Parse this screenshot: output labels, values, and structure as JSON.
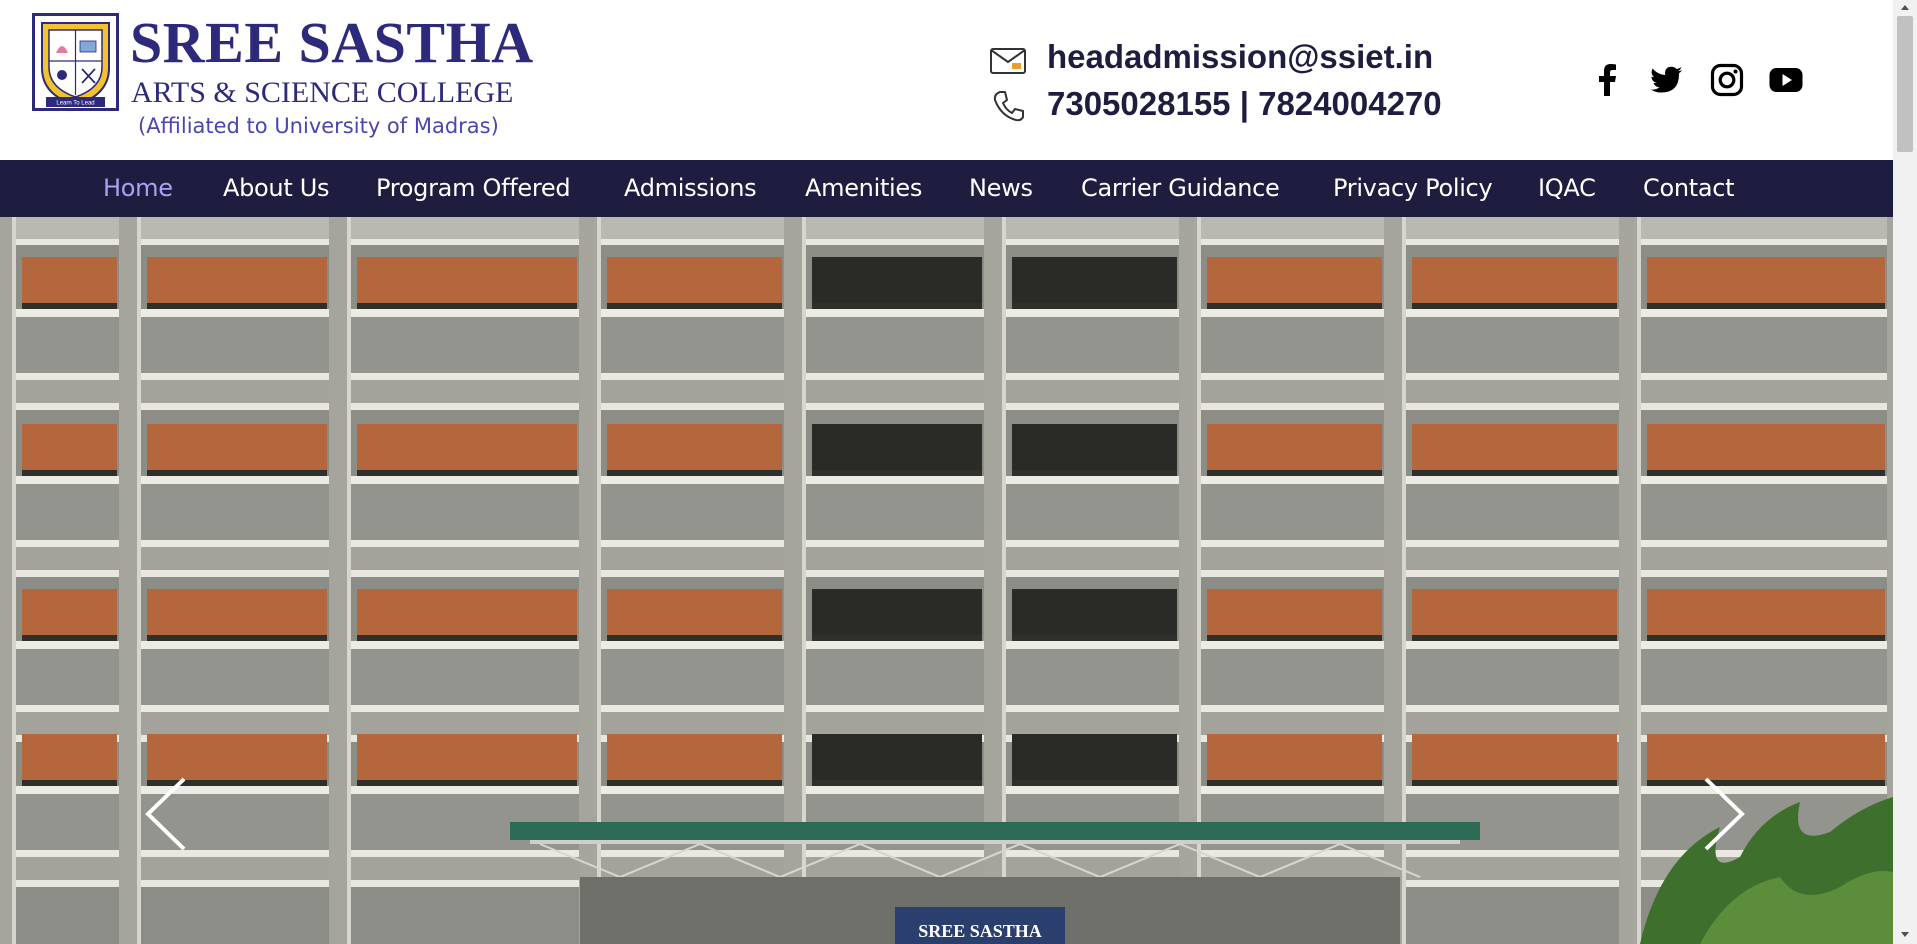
{
  "brand": {
    "title": "SREE SASTHA",
    "subtitle": "ARTS & SCIENCE COLLEGE",
    "affiliation": "(Affiliated to University of Madras)",
    "motto": "Learn To Lead",
    "colors": {
      "primary": "#2d2a7b",
      "accent": "#f2c230"
    }
  },
  "contact": {
    "email": "headadmission@ssiet.in",
    "phone": "7305028155 | 7824004270",
    "email_icon": "envelope-icon",
    "phone_icon": "phone-icon"
  },
  "social": [
    {
      "icon": "facebook-icon"
    },
    {
      "icon": "twitter-icon"
    },
    {
      "icon": "instagram-icon"
    },
    {
      "icon": "youtube-icon"
    }
  ],
  "nav": {
    "background": "#1f1d3f",
    "active_color": "#a8a3f0",
    "items": [
      {
        "label": "Home",
        "active": true
      },
      {
        "label": "About Us"
      },
      {
        "label": "Program Offered"
      },
      {
        "label": "Admissions"
      },
      {
        "label": "Amenities"
      },
      {
        "label": "News"
      },
      {
        "label": "Carrier Guidance"
      },
      {
        "label": "Privacy Policy"
      },
      {
        "label": "IQAC"
      },
      {
        "label": "Contact"
      }
    ]
  },
  "hero": {
    "banner_text": "SREE SASTHA",
    "prev_icon": "chevron-left-icon",
    "next_icon": "chevron-right-icon"
  }
}
